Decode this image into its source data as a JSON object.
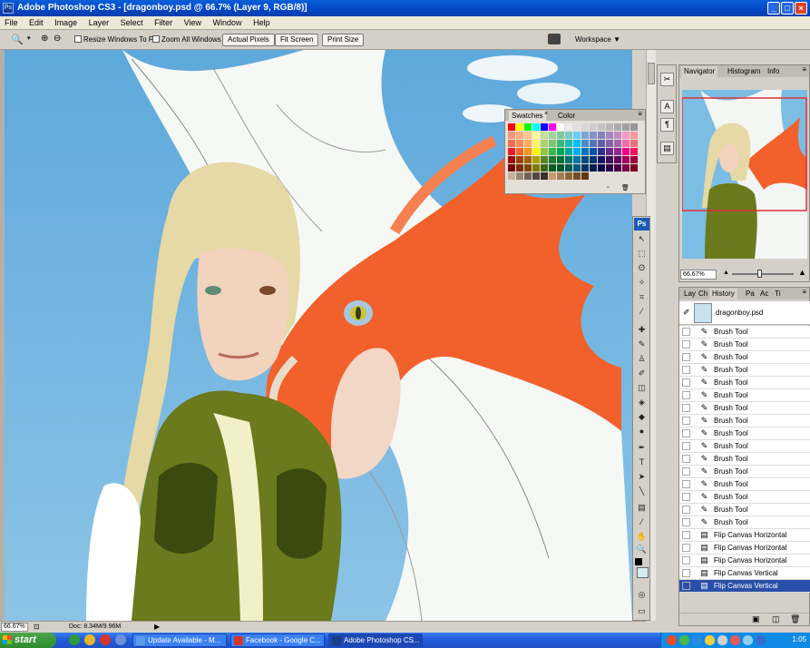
{
  "window": {
    "title": "Adobe Photoshop CS3 - [dragonboy.psd @ 66.7% (Layer 9, RGB/8)]",
    "controls": [
      "_",
      "□",
      "×"
    ]
  },
  "menu": [
    "File",
    "Edit",
    "Image",
    "Layer",
    "Select",
    "Filter",
    "View",
    "Window",
    "Help"
  ],
  "options": {
    "resize_windows": "Resize Windows To Fit",
    "zoom_all": "Zoom All Windows",
    "actual_pixels": "Actual Pixels",
    "fit_screen": "Fit Screen",
    "print_size": "Print Size",
    "workspace": "Workspace ▼"
  },
  "swatches_panel": {
    "tabs": [
      "Swatches",
      "Color"
    ],
    "colors": [
      "#ff0000",
      "#ffff00",
      "#00ff00",
      "#00ffff",
      "#0000ff",
      "#ff00ff",
      "#ffffff",
      "#ebebeb",
      "#e1e1e1",
      "#d7d7d7",
      "#cccccc",
      "#c2c2c2",
      "#b7b7b7",
      "#acacac",
      "#a0a0a0",
      "#959595",
      "#f69679",
      "#f9ad81",
      "#fdc68a",
      "#fff79a",
      "#c4df9b",
      "#a3d39c",
      "#82ca9d",
      "#7accc8",
      "#6dcff6",
      "#7da7d9",
      "#8393ca",
      "#8781bd",
      "#a186be",
      "#bd8cbf",
      "#f49ac1",
      "#f5989d",
      "#f26c4f",
      "#f68e56",
      "#fbaf5c",
      "#fff467",
      "#acd372",
      "#7cc576",
      "#3bb878",
      "#1abbb4",
      "#00bff3",
      "#438ccb",
      "#5574b9",
      "#605ca8",
      "#855fa8",
      "#a763a8",
      "#f06eaa",
      "#f26d7d",
      "#ed1c24",
      "#f26522",
      "#f7941d",
      "#fff200",
      "#8dc73f",
      "#39b54a",
      "#00a651",
      "#00a99d",
      "#00aeef",
      "#0072bc",
      "#0054a6",
      "#2e3192",
      "#662d91",
      "#92278f",
      "#ec008c",
      "#ed145b",
      "#9e0b0f",
      "#a0410d",
      "#a36209",
      "#aba000",
      "#598527",
      "#1a7b30",
      "#007236",
      "#00746b",
      "#0076a3",
      "#004b80",
      "#003471",
      "#1b1464",
      "#440e62",
      "#630460",
      "#9e005d",
      "#9e0039",
      "#790000",
      "#7b2e00",
      "#7d4900",
      "#827b00",
      "#406618",
      "#005e20",
      "#005826",
      "#005952",
      "#005b7f",
      "#003663",
      "#002157",
      "#0d004c",
      "#32004b",
      "#4b0049",
      "#7b0046",
      "#7a0026",
      "#c7b299",
      "#998675",
      "#736357",
      "#534741",
      "#37302d",
      "#c69c6d",
      "#a67c52",
      "#8c6239",
      "#754c24",
      "#603913"
    ]
  },
  "navigator": {
    "tabs": [
      "Navigator",
      "Histogram",
      "Info"
    ],
    "zoom": "66.67%"
  },
  "history": {
    "tabs": [
      "Lay",
      "Ch",
      "History",
      "Pa",
      "Ac",
      "Ti"
    ],
    "snapshot": "dragonboy.psd",
    "steps": [
      "Brush Tool",
      "Brush Tool",
      "Brush Tool",
      "Brush Tool",
      "Brush Tool",
      "Brush Tool",
      "Brush Tool",
      "Brush Tool",
      "Brush Tool",
      "Brush Tool",
      "Brush Tool",
      "Brush Tool",
      "Brush Tool",
      "Brush Tool",
      "Brush Tool",
      "Brush Tool",
      "Flip Canvas Horizontal",
      "Flip Canvas Horizontal",
      "Flip Canvas Horizontal",
      "Flip Canvas Vertical",
      "Flip Canvas Vertical"
    ],
    "selected_index": 20
  },
  "status": {
    "zoom": "66.67%",
    "doc": "Doc: 8.34M/9.96M"
  },
  "taskbar": {
    "start": "start",
    "tasks": [
      "Update Available - M...",
      "Facebook - Google C...",
      "Adobe Photoshop CS..."
    ],
    "active_index": 2,
    "clock": "1:05"
  },
  "colors": {
    "title_bar": "#0346c6",
    "taskbar": "#245edb",
    "history_selected": "#2a4fa8",
    "sky": "#6fb3de",
    "dragon": "#f2612b",
    "jacket": "#6a7a1c"
  }
}
